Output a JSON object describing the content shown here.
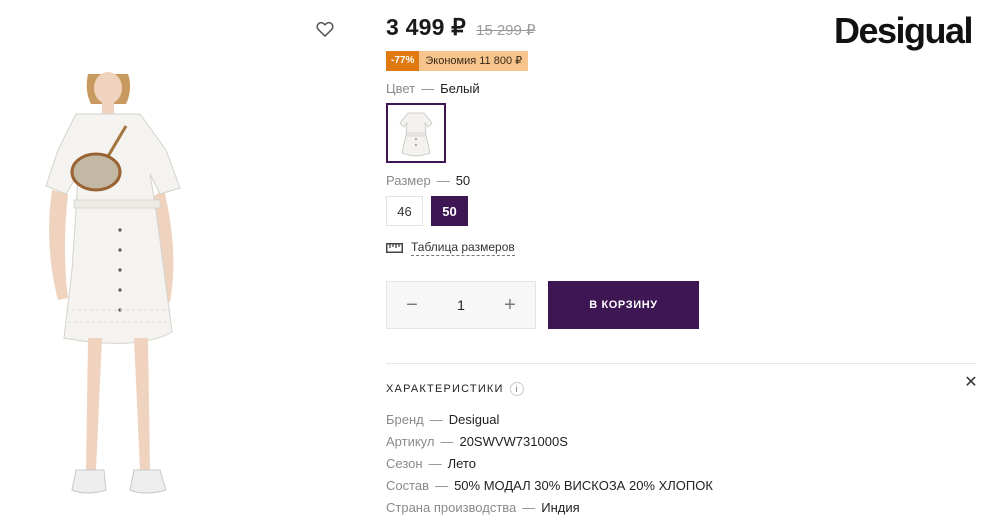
{
  "product": {
    "price": "3 499 ₽",
    "old_price": "15 299 ₽",
    "discount_badge": "-77%",
    "savings_badge": "Экономия 11 800 ₽",
    "brand_logo": "Desigual"
  },
  "color": {
    "label": "Цвет",
    "value": "Белый",
    "swatch_icon": "dress-thumbnail"
  },
  "size": {
    "label": "Размер",
    "value": "50",
    "options": [
      "46",
      "50"
    ]
  },
  "size_table": {
    "label": "Таблица размеров",
    "icon": "ruler-icon"
  },
  "quantity": {
    "minus": "−",
    "value": "1",
    "plus": "+"
  },
  "cart_button": "В КОРЗИНУ",
  "characteristics": {
    "title": "ХАРАКТЕРИСТИКИ",
    "info_icon": "i",
    "close_icon": "✕",
    "items": [
      {
        "name": "Бренд",
        "value": "Desigual"
      },
      {
        "name": "Артикул",
        "value": "20SWVW731000S"
      },
      {
        "name": "Сезон",
        "value": "Лето"
      },
      {
        "name": "Состав",
        "value": "50% МОДАЛ 30% ВИСКОЗА 20% ХЛОПОК"
      },
      {
        "name": "Страна производства",
        "value": "Индия"
      }
    ]
  },
  "colors": {
    "accent": "#3e1654",
    "discount": "#e07a10",
    "savings": "#f5c58d"
  }
}
